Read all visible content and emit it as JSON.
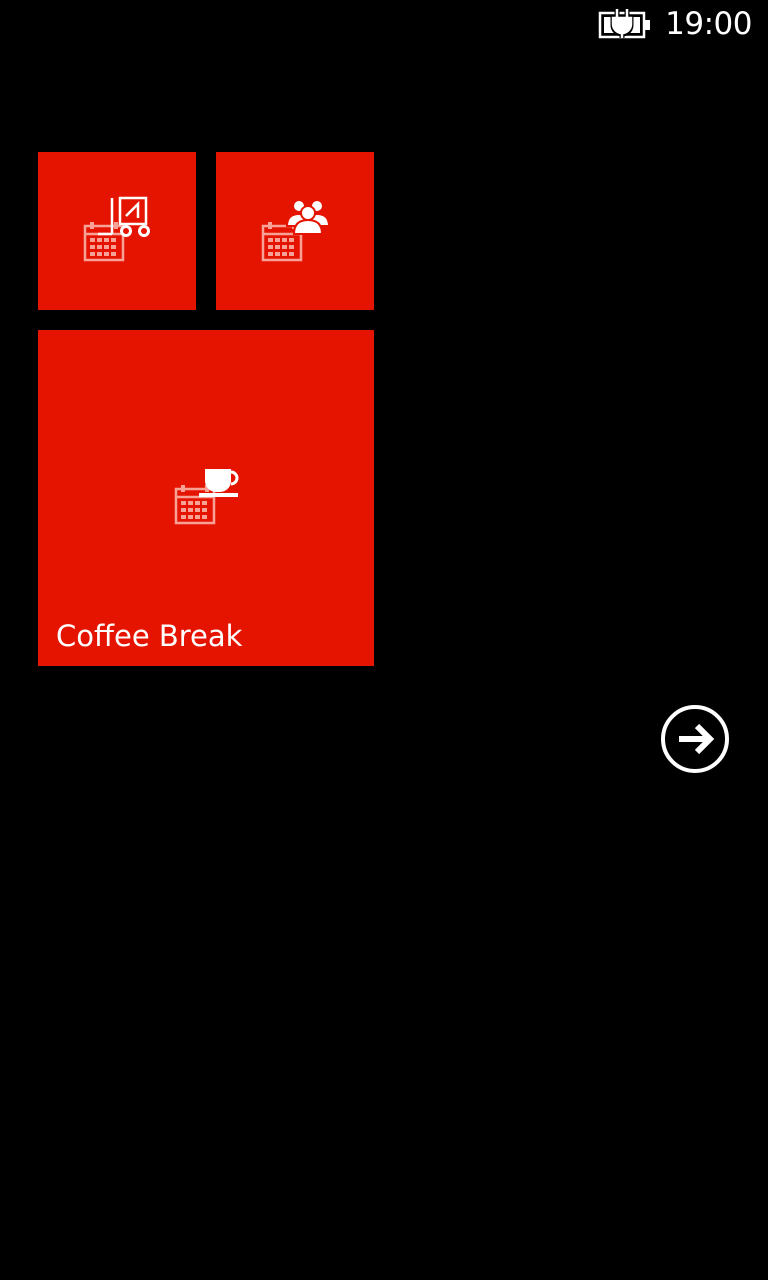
{
  "status_bar": {
    "time": "19:00",
    "battery_icon": "battery-charging-icon"
  },
  "tiles": [
    {
      "id": "tile-1",
      "label": "",
      "icon": "calendar-forklift-icon"
    },
    {
      "id": "tile-2",
      "label": "",
      "icon": "calendar-group-icon"
    },
    {
      "id": "tile-3",
      "label": "Coffee Break",
      "icon": "calendar-coffee-icon"
    }
  ],
  "navigation": {
    "next_icon": "arrow-right-circle-icon"
  },
  "colors": {
    "background": "#000000",
    "tile_accent": "#e51400",
    "foreground": "#ffffff"
  }
}
